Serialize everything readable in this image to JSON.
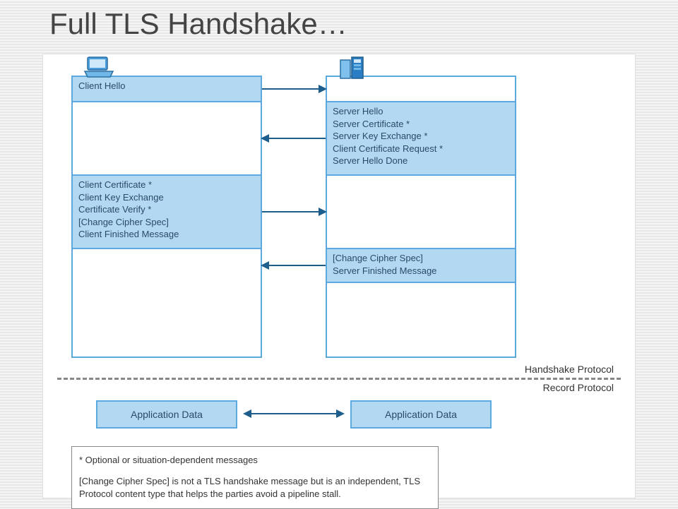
{
  "title": "Full TLS Handshake…",
  "client_rows": {
    "r0": "Client Hello",
    "r1": "",
    "r2": "Client Certificate *\nClient Key Exchange\nCertificate Verify *\n[Change Cipher Spec]\nClient Finished Message",
    "r3": ""
  },
  "server_rows": {
    "r0": "",
    "r1": "Server Hello\nServer Certificate *\nServer Key Exchange *\nClient Certificate Request *\nServer Hello Done",
    "r2": "",
    "r3": "[Change Cipher Spec]\nServer Finished Message"
  },
  "divider": {
    "top": "Handshake Protocol",
    "bottom": "Record Protocol"
  },
  "appdata": {
    "client": "Application Data",
    "server": "Application Data"
  },
  "footnote": {
    "l1": "* Optional or situation-dependent messages",
    "l2": "[Change Cipher Spec] is not a TLS handshake message but is an independent, TLS Protocol content type that helps the parties avoid a pipeline stall."
  },
  "row_heights": {
    "r0": 36,
    "r1": 104,
    "r2": 104,
    "r3": 48
  }
}
